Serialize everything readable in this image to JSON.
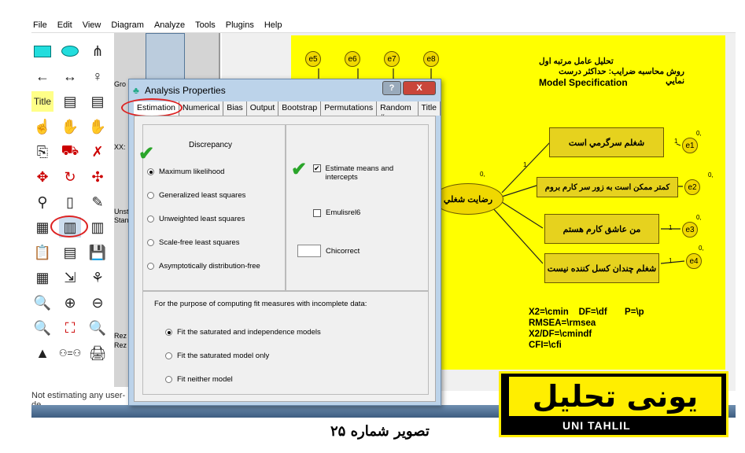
{
  "menu": [
    "File",
    "Edit",
    "View",
    "Diagram",
    "Analyze",
    "Tools",
    "Plugins",
    "Help"
  ],
  "panel": {
    "groups_label": "Gro",
    "xx_label": "XX:",
    "unst_label": "Unst",
    "stan_label": "Stan",
    "rez1": "Rez",
    "rez2": "Rez"
  },
  "status": "Not estimating any user-de",
  "diagram": {
    "title1": "تحليل عامل مرتبه اول",
    "title2": "روش محاسبه ضرايب: حداكثر درست نمايي",
    "title3": "Model Specification",
    "latent": "رضايت شغلي",
    "items": [
      "شغلم سرگرمي است",
      "كمتر ممكن است به زور  سر كارم بروم",
      "من عاشق كارم هستم",
      "شغلم چندان كسل كننده نيست"
    ],
    "errors": [
      "e1",
      "e2",
      "e3",
      "e4"
    ],
    "top_errors": [
      "e5",
      "e6",
      "e7",
      "e8"
    ],
    "zero": "0,",
    "one": "1",
    "fit": [
      "X2=\\cmin    DF=\\df       P=\\p",
      "RMSEA=\\rmsea",
      "X2/DF=\\cmindf",
      "CFI=\\cfi"
    ]
  },
  "dialog": {
    "title": "Analysis Properties",
    "help": "?",
    "close": "X",
    "tabs": [
      "Estimation",
      "Numerical",
      "Bias",
      "Output",
      "Bootstrap",
      "Permutations",
      "Random #",
      "Title"
    ],
    "active_tab": "Estimation",
    "discrepancy_label": "Discrepancy",
    "discrepancy": [
      "Maximum likelihood",
      "Generalized least squares",
      "Unweighted least squares",
      "Scale-free least squares",
      "Asymptotically distribution-free"
    ],
    "discrepancy_selected": "Maximum likelihood",
    "estimate_means": "Estimate means and intercepts",
    "estimate_means_checked": true,
    "emulisrel": "Emulisrel6",
    "emulisrel_checked": false,
    "chicorrect": "Chicorrect",
    "chicorrect_value": "",
    "incomplete_label": "For the purpose of computing fit measures with incomplete data:",
    "fit_options": [
      "Fit the saturated and independence models",
      "Fit the saturated model only",
      "Fit neither model"
    ],
    "fit_selected": "Fit the saturated and independence models"
  },
  "caption": "تصوير شماره ۲۵",
  "logo": {
    "text": "UNI TAHLIL",
    "persian": "یونی تحلیل"
  }
}
